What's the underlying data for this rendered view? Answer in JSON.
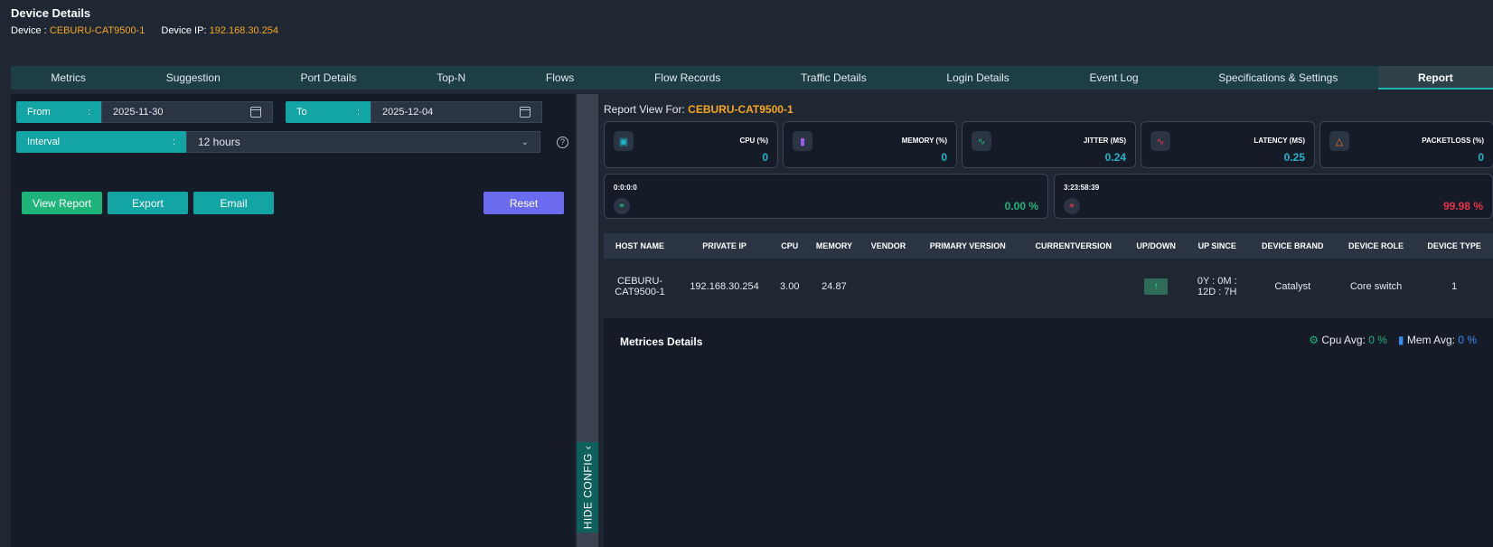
{
  "header": {
    "title": "Device Details",
    "device_label": "Device :",
    "device_name": "CEBURU-CAT9500-1",
    "ip_label": "Device IP:",
    "ip": "192.168.30.254"
  },
  "tabs": [
    {
      "label": "Metrics"
    },
    {
      "label": "Suggestion"
    },
    {
      "label": "Port Details"
    },
    {
      "label": "Top-N"
    },
    {
      "label": "Flows"
    },
    {
      "label": "Flow Records"
    },
    {
      "label": "Traffic Details"
    },
    {
      "label": "Login Details"
    },
    {
      "label": "Event Log"
    },
    {
      "label": "Specifications & Settings"
    },
    {
      "label": "Report"
    }
  ],
  "active_tab": "Report",
  "config": {
    "from_label": "From",
    "from_value": "2025-11-30",
    "to_label": "To",
    "to_value": "2025-12-04",
    "interval_label": "Interval",
    "interval_value": "12 hours",
    "colon": ":",
    "help": "?",
    "view_report": "View Report",
    "export": "Export",
    "email": "Email",
    "reset": "Reset",
    "hide_config": "HIDE CONFIG"
  },
  "report": {
    "view_for_label": "Report View For:",
    "device": "CEBURU-CAT9500-1",
    "cards": [
      {
        "label": "CPU (%)",
        "value": "0",
        "icon": "cpu-icon",
        "color": "#1fb5c8"
      },
      {
        "label": "MEMORY (%)",
        "value": "0",
        "icon": "memory-icon",
        "color": "#9b59f0"
      },
      {
        "label": "JITTER (MS)",
        "value": "0.24",
        "icon": "pulse-icon",
        "color": "#1fb57a"
      },
      {
        "label": "LATENCY (MS)",
        "value": "0.25",
        "icon": "latency-icon",
        "color": "#e8334a"
      },
      {
        "label": "PACKETLOSS (%)",
        "value": "0",
        "icon": "warning-icon",
        "color": "#f07a2a"
      }
    ],
    "uptime": {
      "time": "0:0:0:0",
      "pct": "0.00 %",
      "color": "#1fb57a"
    },
    "downtime": {
      "time": "3:23:58:39",
      "pct": "99.98 %",
      "color": "#e8334a"
    }
  },
  "table": {
    "headers": [
      "HOST NAME",
      "PRIVATE IP",
      "CPU",
      "MEMORY",
      "VENDOR",
      "PRIMARY VERSION",
      "CURRENTVERSION",
      "UP/DOWN",
      "UP SINCE",
      "DEVICE BRAND",
      "DEVICE ROLE",
      "DEVICE TYPE"
    ],
    "row": {
      "host": "CEBURU-CAT9500-1",
      "ip": "192.168.30.254",
      "cpu": "3.00",
      "memory": "24.87",
      "vendor": "",
      "primary_version": "",
      "current_version": "",
      "up_since": "0Y : 0M : 12D : 7H",
      "brand": "Catalyst",
      "role": "Core switch",
      "type": "1"
    }
  },
  "metrics": {
    "title": "Metrices Details",
    "cpu_avg_label": "Cpu Avg:",
    "cpu_avg_value": "0 %",
    "mem_avg_label": "Mem Avg:",
    "mem_avg_value": "0 %"
  }
}
